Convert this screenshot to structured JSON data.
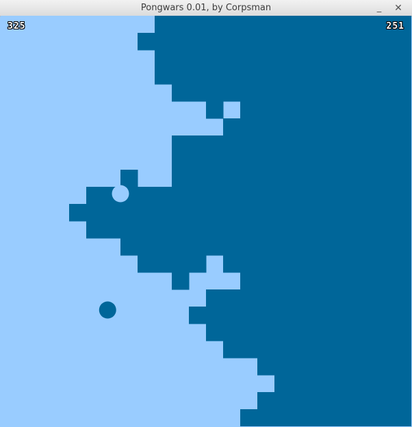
{
  "window": {
    "title": "Pongwars 0.01, by Corpsman",
    "minimize_label": "_",
    "close_label": "✕"
  },
  "scores": {
    "light": "325",
    "dark": "251"
  },
  "colors": {
    "light": "#99ccff",
    "dark": "#006699"
  },
  "game": {
    "grid_size": 24,
    "dark_rows": [
      [
        9,
        23
      ],
      [
        8,
        23
      ],
      [
        9,
        23
      ],
      [
        9,
        23
      ],
      [
        10,
        23
      ],
      [
        12,
        12,
        14,
        23
      ],
      [
        13,
        23
      ],
      [
        10,
        23
      ],
      [
        10,
        23
      ],
      [
        7,
        7,
        10,
        23
      ],
      [
        5,
        23
      ],
      [
        4,
        23
      ],
      [
        5,
        23
      ],
      [
        7,
        23
      ],
      [
        8,
        11,
        13,
        23
      ],
      [
        10,
        10,
        14,
        23
      ],
      [
        12,
        23
      ],
      [
        11,
        23
      ],
      [
        12,
        23
      ],
      [
        13,
        23
      ],
      [
        15,
        23
      ],
      [
        16,
        23
      ],
      [
        15,
        23
      ],
      [
        14,
        23
      ]
    ],
    "balls": [
      {
        "team": "light",
        "col": 7.0,
        "row": 10.4
      },
      {
        "team": "dark",
        "col": 6.25,
        "row": 17.2
      }
    ]
  }
}
